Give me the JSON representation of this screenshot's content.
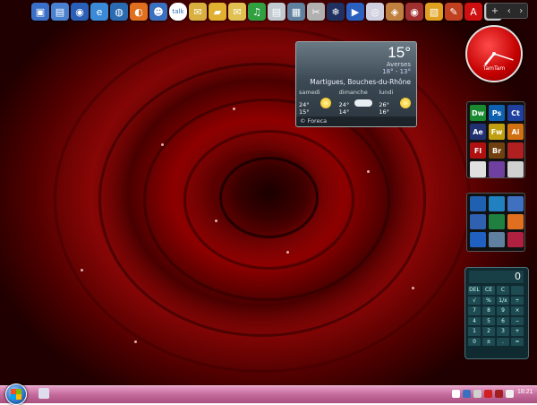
{
  "quicklaunch": {
    "icons": [
      {
        "name": "network-icon",
        "color": "#3a6fc8",
        "glyph": "▣"
      },
      {
        "name": "computer-icon",
        "color": "#4a80d0",
        "glyph": "▤"
      },
      {
        "name": "globe-icon",
        "color": "#2a5fb8",
        "glyph": "◉"
      },
      {
        "name": "ie-icon",
        "color": "#3a8ad8",
        "glyph": "e"
      },
      {
        "name": "browser-icon",
        "color": "#2a6ab0",
        "glyph": "◍"
      },
      {
        "name": "firefox-icon",
        "color": "#e07020",
        "glyph": "◐"
      },
      {
        "name": "contacts-icon",
        "color": "#3a70c0",
        "glyph": "☻"
      },
      {
        "name": "talk-icon",
        "color": "#ffffff",
        "glyph": "talk"
      },
      {
        "name": "mail-icon",
        "color": "#d8b040",
        "glyph": "✉"
      },
      {
        "name": "folder-icon",
        "color": "#e0b030",
        "glyph": "▰"
      },
      {
        "name": "email-icon",
        "color": "#e0c050",
        "glyph": "✉"
      },
      {
        "name": "music-icon",
        "color": "#30a040",
        "glyph": "♫"
      },
      {
        "name": "document-icon",
        "color": "#c0c8d0",
        "glyph": "▤"
      },
      {
        "name": "media-icon",
        "color": "#6080a0",
        "glyph": "▦"
      },
      {
        "name": "tools-icon",
        "color": "#b0b0b0",
        "glyph": "✂"
      },
      {
        "name": "app-icon",
        "color": "#203060",
        "glyph": "❄"
      },
      {
        "name": "play-icon",
        "color": "#2a60c0",
        "glyph": "▶"
      },
      {
        "name": "disc-icon",
        "color": "#d0d0e0",
        "glyph": "◎"
      },
      {
        "name": "game-icon",
        "color": "#c08040",
        "glyph": "◈"
      },
      {
        "name": "settings-icon",
        "color": "#a03030",
        "glyph": "◉"
      },
      {
        "name": "store-icon",
        "color": "#e0a020",
        "glyph": "▧"
      },
      {
        "name": "paint-icon",
        "color": "#c04020",
        "glyph": "✎"
      },
      {
        "name": "acrobat-icon",
        "color": "#d01010",
        "glyph": "A"
      },
      {
        "name": "trash-icon",
        "color": "#c8c8c8",
        "glyph": "▯"
      }
    ]
  },
  "clock": {
    "brand": "TamTam",
    "hour": 7,
    "minute": 18
  },
  "weather": {
    "temp": "15°",
    "condition": "Averses",
    "range": "18° - 13°",
    "location": "Martigues, Bouches-du-Rhône",
    "days": [
      {
        "name": "samedi",
        "high": "24°",
        "low": "15°",
        "icon": "sun"
      },
      {
        "name": "dimanche",
        "high": "24°",
        "low": "14°",
        "icon": "cloud"
      },
      {
        "name": "lundi",
        "high": "26°",
        "low": "16°",
        "icon": "sun"
      }
    ],
    "provider": "© Foreca"
  },
  "adobe_apps": [
    {
      "label": "Dw",
      "color": "#1a8a30"
    },
    {
      "label": "Ps",
      "color": "#1060b0"
    },
    {
      "label": "Ct",
      "color": "#2040a0"
    },
    {
      "label": "Ae",
      "color": "#203070"
    },
    {
      "label": "Fw",
      "color": "#c0a010"
    },
    {
      "label": "Ai",
      "color": "#d07010"
    },
    {
      "label": "Fl",
      "color": "#b01010"
    },
    {
      "label": "Br",
      "color": "#704010"
    },
    {
      "label": "",
      "color": "#b02020"
    },
    {
      "label": "",
      "color": "#e0e0e0"
    },
    {
      "label": "",
      "color": "#7040a0"
    },
    {
      "label": "",
      "color": "#d0d0d0"
    }
  ],
  "office_apps": [
    {
      "name": "office-icon",
      "color": "#2060b0"
    },
    {
      "name": "publisher-icon",
      "color": "#2080c0"
    },
    {
      "name": "notes-icon",
      "color": "#4070c0"
    },
    {
      "name": "word-icon",
      "color": "#3060b0"
    },
    {
      "name": "excel-icon",
      "color": "#208040"
    },
    {
      "name": "powerpoint-icon",
      "color": "#e07020"
    },
    {
      "name": "outlook-icon",
      "color": "#2060c0"
    },
    {
      "name": "infopath-icon",
      "color": "#6080a0"
    },
    {
      "name": "access-icon",
      "color": "#b02040"
    }
  ],
  "calculator": {
    "display": "0",
    "keys": [
      "DEL",
      "CE",
      "C",
      "",
      "√",
      "%",
      "1/x",
      "÷",
      "7",
      "8",
      "9",
      "×",
      "4",
      "5",
      "6",
      "−",
      "1",
      "2",
      "3",
      "+",
      "0",
      "±",
      ".",
      "="
    ]
  },
  "taskbar": {
    "time": "18:21"
  }
}
